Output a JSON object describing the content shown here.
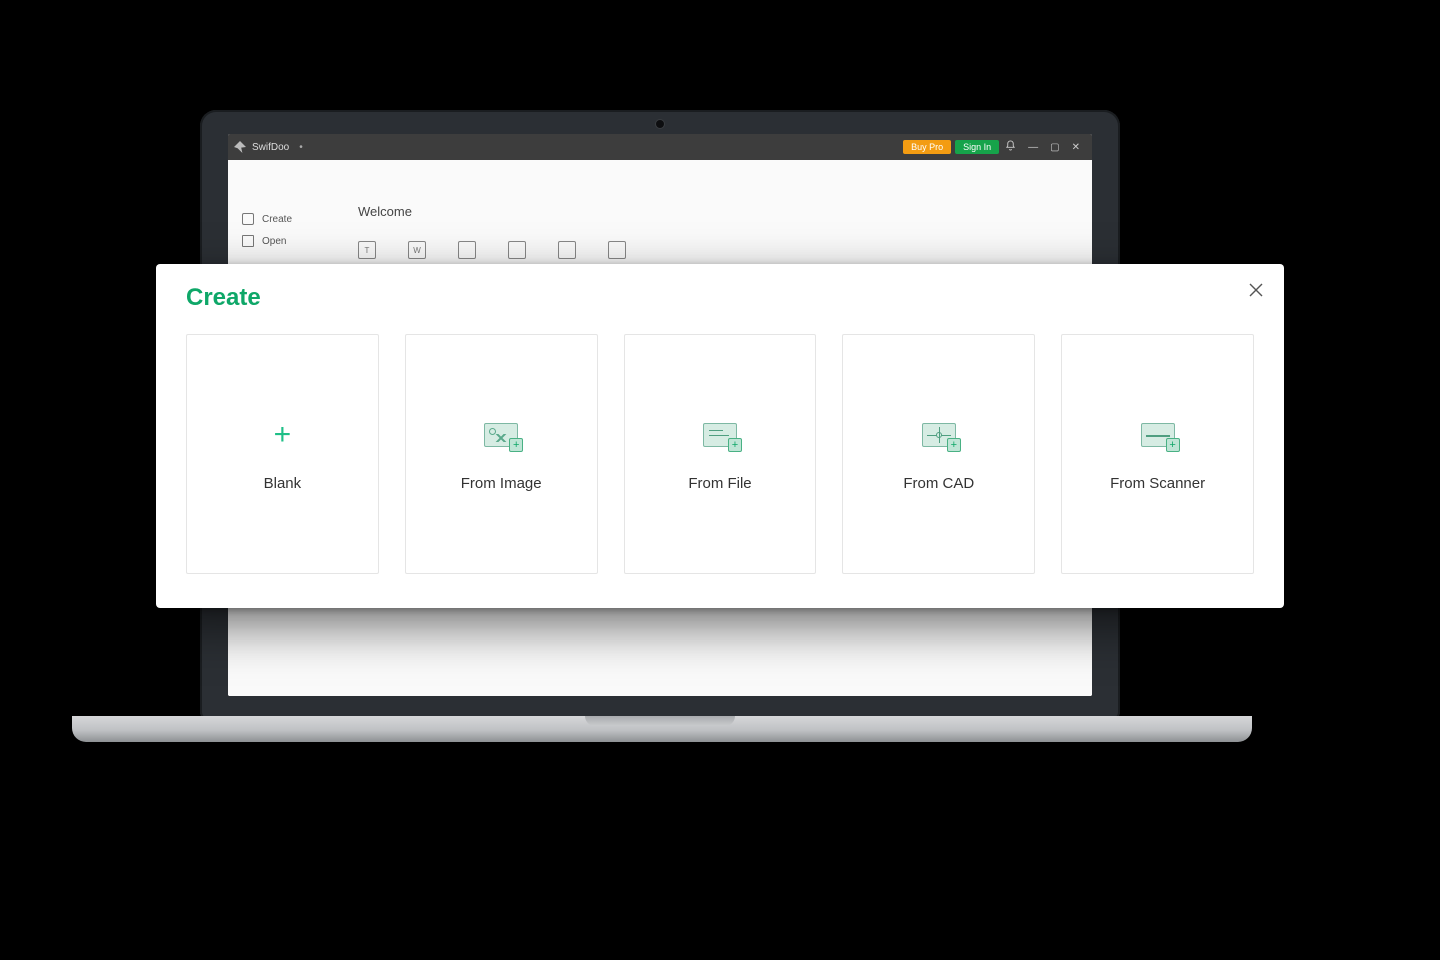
{
  "app": {
    "name": "SwifDoo",
    "titlebar": {
      "buy_label": "Buy Pro",
      "signin_label": "Sign In"
    },
    "sidebar": {
      "items": [
        {
          "label": "Create"
        },
        {
          "label": "Open"
        }
      ]
    },
    "main": {
      "welcome": "Welcome",
      "tools": [
        "T",
        "W",
        "",
        "",
        "",
        ""
      ]
    }
  },
  "dialog": {
    "title": "Create",
    "cards": [
      {
        "label": "Blank"
      },
      {
        "label": "From Image"
      },
      {
        "label": "From File"
      },
      {
        "label": "From CAD"
      },
      {
        "label": "From Scanner"
      }
    ]
  },
  "colors": {
    "accent": "#0ea768",
    "buy": "#f39c12",
    "signin": "#16a34a"
  }
}
